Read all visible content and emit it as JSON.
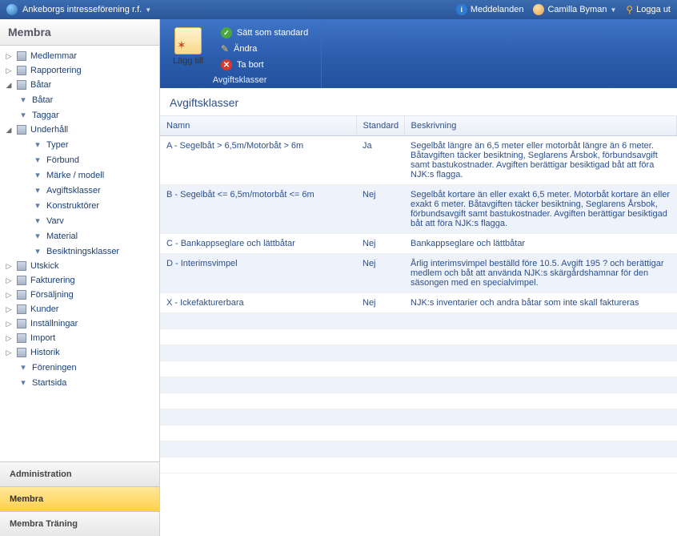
{
  "top": {
    "org": "Ankeborgs intresseförening r.f.",
    "messages": "Meddelanden",
    "user": "Camilla Byman",
    "logout": "Logga ut"
  },
  "sidebar": {
    "title": "Membra",
    "nav": {
      "medlemmar": "Medlemmar",
      "rapportering": "Rapportering",
      "batar": "Båtar",
      "batar_sub": "Båtar",
      "taggar": "Taggar",
      "underhall": "Underhåll",
      "typer": "Typer",
      "forbund": "Förbund",
      "marke": "Märke / modell",
      "avgiftsklasser": "Avgiftsklasser",
      "konstruktorer": "Konstruktörer",
      "varv": "Varv",
      "material": "Material",
      "besiktningsklasser": "Besiktningsklasser",
      "utskick": "Utskick",
      "fakturering": "Fakturering",
      "forsaljning": "Försäljning",
      "kunder": "Kunder",
      "installningar": "Inställningar",
      "import": "Import",
      "historik": "Historik",
      "foreningen": "Föreningen",
      "startsida": "Startsida"
    },
    "panels": {
      "admin": "Administration",
      "membra": "Membra",
      "traning": "Membra Träning"
    }
  },
  "ribbon": {
    "add": "Lägg till",
    "setdefault": "Sätt som standard",
    "edit": "Ändra",
    "delete": "Ta bort",
    "group": "Avgiftsklasser"
  },
  "list": {
    "title": "Avgiftsklasser",
    "cols": {
      "name": "Namn",
      "standard": "Standard",
      "desc": "Beskrivning"
    },
    "rows": [
      {
        "name": "A - Segelbåt > 6,5m/Motorbåt > 6m",
        "std": "Ja",
        "desc": "Segelbåt längre än 6,5 meter eller motorbåt längre än 6 meter. Båtavgiften täcker besiktning, Seglarens Årsbok, förbundsavgift samt bastukostnader. Avgiften berättigar besiktigad båt att föra NJK:s flagga."
      },
      {
        "name": "B - Segelbåt <= 6,5m/motorbåt <= 6m",
        "std": "Nej",
        "desc": "Segelbåt kortare än eller exakt 6,5 meter. Motorbåt kortare än eller exakt 6 meter. Båtavgiften täcker besiktning, Seglarens Årsbok, förbundsavgift samt bastukostnader. Avgiften berättigar besiktigad båt att föra NJK:s flagga."
      },
      {
        "name": "C - Bankappseglare och lättbåtar",
        "std": "Nej",
        "desc": "Bankappseglare och lättbåtar"
      },
      {
        "name": "D - Interimsvimpel",
        "std": "Nej",
        "desc": "Årlig interimsvimpel beställd före 10.5. Avgift 195 ? och berättigar medlem och båt att använda NJK:s skärgårdshamnar för den säsongen med en specialvimpel."
      },
      {
        "name": "X - Ickefakturerbara",
        "std": "Nej",
        "desc": "NJK:s inventarier och andra båtar som inte skall faktureras"
      }
    ]
  }
}
